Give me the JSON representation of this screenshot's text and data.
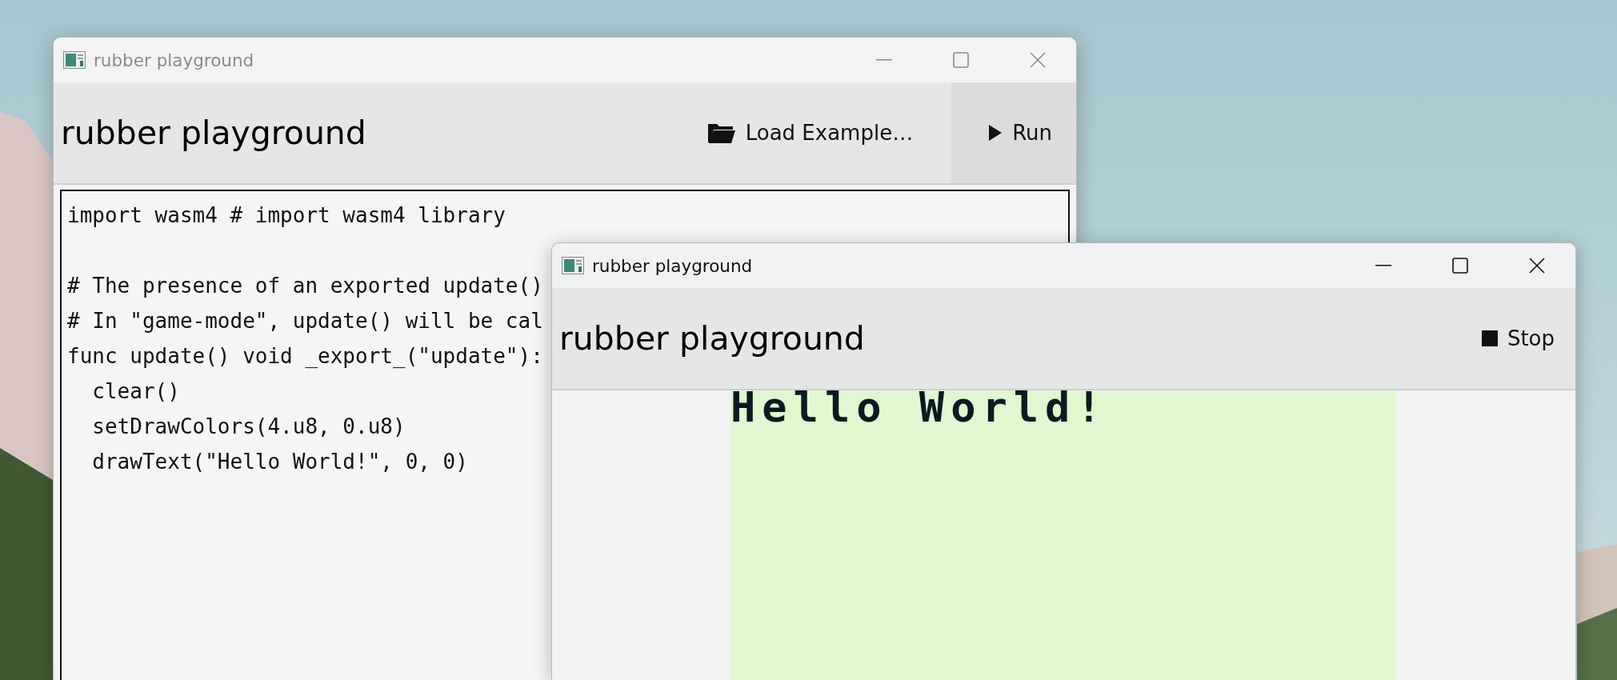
{
  "windows": [
    {
      "title": "rubber playground",
      "active": false,
      "heading": "rubber playground",
      "kind": "editor",
      "buttons": [
        {
          "label": "Load Example…",
          "kind": "load"
        },
        {
          "label": "Run",
          "kind": "run"
        }
      ],
      "code_blocks": [
        {
          "lines": [
            "import wasm4 # import wasm4 library"
          ]
        },
        {
          "lines": [
            "# The presence of an exported update()",
            "# In \"game-mode\", update() will be cal",
            "func update() void _export_(\"update\"):",
            "  clear()",
            "  setDrawColors(4.u8, 0.u8)",
            "  drawText(\"Hello World!\", 0, 0)"
          ]
        }
      ]
    },
    {
      "title": "rubber playground",
      "active": true,
      "heading": "rubber playground",
      "kind": "game",
      "buttons": [
        {
          "label": "Stop",
          "kind": "stop"
        }
      ],
      "screen_text": "Hello World!"
    }
  ]
}
